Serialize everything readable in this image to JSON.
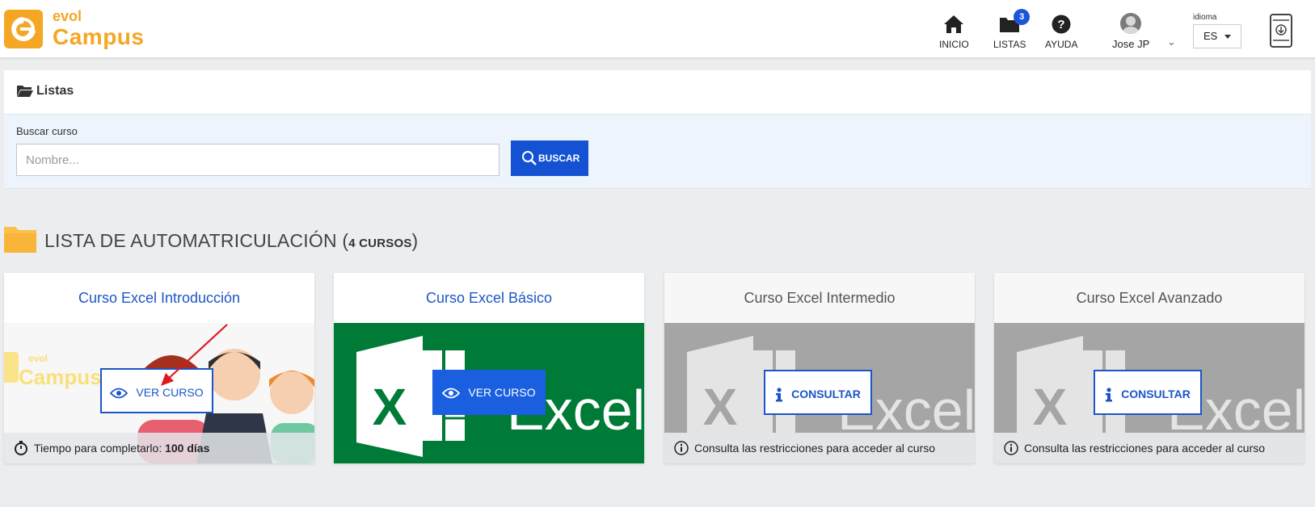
{
  "header": {
    "logo": {
      "small": "evol",
      "large": "Campus"
    },
    "nav": [
      {
        "label": "INICIO",
        "icon": "home-icon"
      },
      {
        "label": "LISTAS",
        "icon": "folder-icon",
        "badge": "3"
      },
      {
        "label": "AYUDA",
        "icon": "help-icon"
      }
    ],
    "user": {
      "name": "Jose JP"
    },
    "language": {
      "label": "idioma",
      "value": "ES"
    }
  },
  "panel": {
    "title": "Listas"
  },
  "search": {
    "label": "Buscar curso",
    "placeholder": "Nombre...",
    "button": "BUSCAR"
  },
  "section": {
    "title": "LISTA DE AUTOMATRICULACIÓN",
    "count": "4 CURSOS"
  },
  "courses": [
    {
      "title": "Curso Excel Introducción",
      "button": "VER CURSO",
      "footer_label": "Tiempo para completarlo:",
      "footer_value": "100 días",
      "status": "active"
    },
    {
      "title": "Curso Excel Básico",
      "button": "VER CURSO",
      "status": "active"
    },
    {
      "title": "Curso Excel Intermedio",
      "button": "CONSULTAR",
      "footer_label": "Consulta las restricciones para acceder al curso",
      "status": "disabled"
    },
    {
      "title": "Curso Excel Avanzado",
      "button": "CONSULTAR",
      "footer_label": "Consulta las restricciones para acceder al curso",
      "status": "disabled"
    }
  ],
  "card_images": {
    "excel_word": "Excel",
    "excel_letter": "X"
  },
  "colors": {
    "brand_orange": "#f5a623",
    "primary_blue": "#1552d3",
    "excel_green": "#007a37"
  }
}
